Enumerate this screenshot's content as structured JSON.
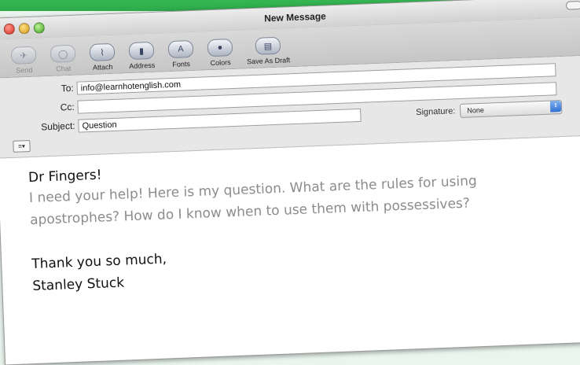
{
  "window": {
    "title": "New Message"
  },
  "toolbar": {
    "buttons": [
      {
        "label": "Send",
        "icon": "send-icon",
        "glyph": "✈",
        "disabled": true
      },
      {
        "label": "Chat",
        "icon": "chat-icon",
        "glyph": "◯",
        "disabled": true
      },
      {
        "label": "Attach",
        "icon": "paperclip-icon",
        "glyph": "⌇",
        "disabled": false
      },
      {
        "label": "Address",
        "icon": "address-book-icon",
        "glyph": "▮",
        "disabled": false
      },
      {
        "label": "Fonts",
        "icon": "fonts-icon",
        "glyph": "A",
        "disabled": false
      },
      {
        "label": "Colors",
        "icon": "colors-icon",
        "glyph": "●",
        "disabled": false
      },
      {
        "label": "Save As Draft",
        "icon": "draft-icon",
        "glyph": "▤",
        "disabled": false
      }
    ]
  },
  "header": {
    "to_label": "To:",
    "to_value": "info@learnhotenglish.com",
    "cc_label": "Cc:",
    "cc_value": "",
    "subject_label": "Subject:",
    "subject_value": "Question",
    "signature_label": "Signature:",
    "signature_value": "None"
  },
  "message": {
    "greeting": "Dr Fingers!",
    "paragraph": "I need your help! Here is my question. What are the rules for using apostrophes? How do I know when to use them with possessives?",
    "closing_line1": "Thank you so much,",
    "closing_line2": "Stanley Stuck"
  }
}
